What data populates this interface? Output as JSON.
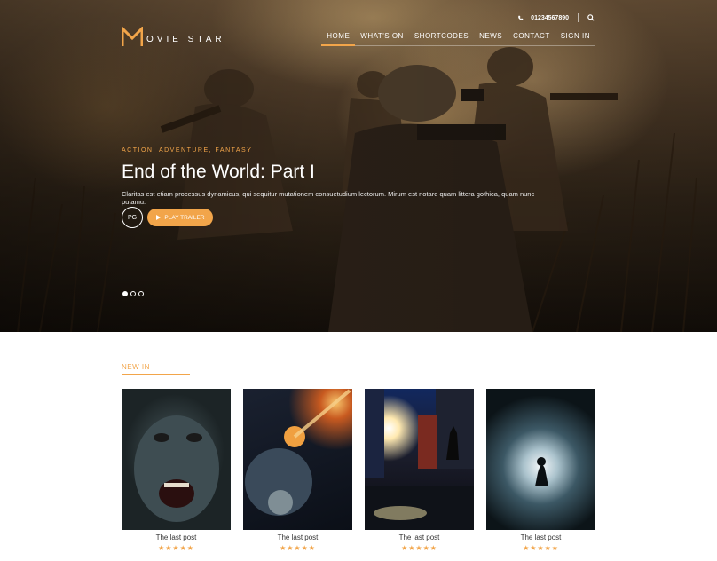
{
  "brand": {
    "logo_letter": "M",
    "logo_text": "OVIE STAR",
    "accent": "#f2a54a"
  },
  "topbar": {
    "phone_icon": "phone-icon",
    "phone": "01234567890",
    "search_icon": "search-icon"
  },
  "nav": {
    "items": [
      {
        "label": "HOME",
        "active": true
      },
      {
        "label": "WHAT'S ON",
        "active": false
      },
      {
        "label": "SHORTCODES",
        "active": false
      },
      {
        "label": "NEWS",
        "active": false
      },
      {
        "label": "CONTACT",
        "active": false
      },
      {
        "label": "SIGN IN",
        "active": false
      }
    ]
  },
  "hero": {
    "genres": "ACTION, ADVENTURE, FANTASY",
    "title": "End of the World: Part I",
    "description": "Claritas est etiam processus dynamicus, qui sequitur mutationem consuetudium lectorum. Mirum est notare quam littera gothica, quam nunc putamu.",
    "rating": "PG",
    "play_label": "PLAY TRAILER",
    "slides": 3,
    "active_slide": 1
  },
  "new_in": {
    "title": "NEW IN",
    "cards": [
      {
        "title": "The last post",
        "stars": "★★★★★"
      },
      {
        "title": "The last post",
        "stars": "★★★★★"
      },
      {
        "title": "The last post",
        "stars": "★★★★★"
      },
      {
        "title": "The last post",
        "stars": "★★★★★"
      }
    ]
  }
}
